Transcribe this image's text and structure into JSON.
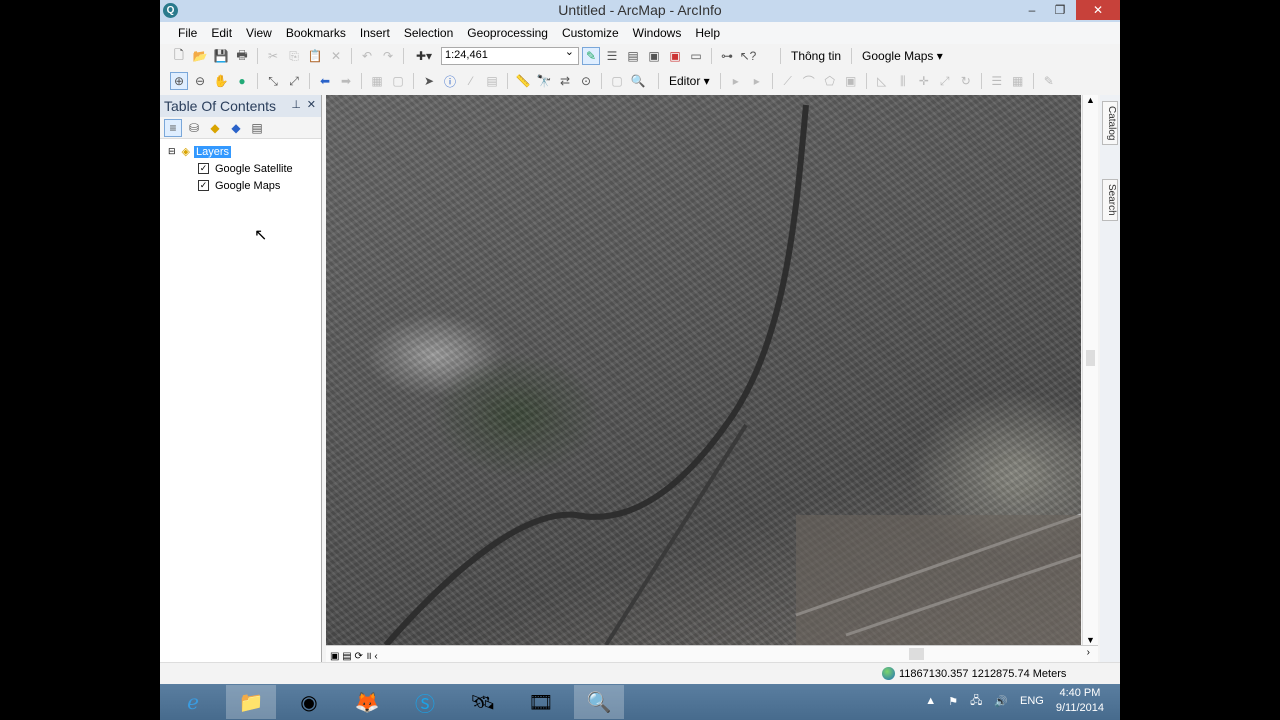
{
  "window": {
    "title": "Untitled - ArcMap - ArcInfo"
  },
  "menu": [
    "File",
    "Edit",
    "View",
    "Bookmarks",
    "Insert",
    "Selection",
    "Geoprocessing",
    "Customize",
    "Windows",
    "Help"
  ],
  "toolbar": {
    "scale": "1:24,461",
    "thong_tin": "Thông tin",
    "google_maps": "Google Maps ▾",
    "editor": "Editor ▾"
  },
  "toc": {
    "title": "Table Of Contents",
    "root": "Layers",
    "layers": [
      {
        "name": "Google Satellite",
        "checked": true
      },
      {
        "name": "Google Maps",
        "checked": true
      }
    ]
  },
  "dock": {
    "catalog": "Catalog",
    "search": "Search"
  },
  "status": {
    "coordinates": "11867130.357  1212875.74 Meters"
  },
  "tray": {
    "lang": "ENG",
    "time": "4:40 PM",
    "date": "9/11/2014"
  }
}
